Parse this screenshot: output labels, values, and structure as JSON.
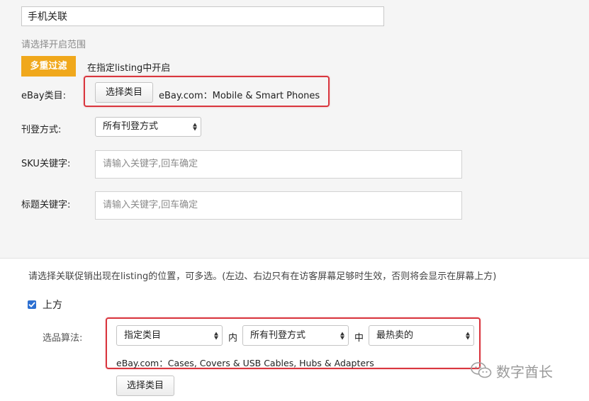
{
  "form": {
    "name_value": "手机关联",
    "range_title": "请选择开启范围",
    "filter_button": "多重过滤",
    "listing_text": "在指定listing中开启",
    "ebay_category": {
      "label": "eBay类目:",
      "button": "选择类目",
      "value": "eBay.com：Mobile & Smart Phones"
    },
    "listing_method": {
      "label": "刊登方式:",
      "selected": "所有刊登方式"
    },
    "sku_keyword": {
      "label": "SKU关键字:",
      "placeholder": "请输入关键字,回车确定"
    },
    "title_keyword": {
      "label": "标题关键字:",
      "placeholder": "请输入关键字,回车确定"
    }
  },
  "position": {
    "instruction": "请选择关联促销出现在listing的位置，可多选。(左边、右边只有在访客屏幕足够时生效，否则将会显示在屏幕上方)",
    "top_checkbox_label": "上方",
    "top_checked": true,
    "algorithm": {
      "label": "选品算法:",
      "select1": "指定类目",
      "in_text": "内",
      "select2": "所有刊登方式",
      "mid_text": "中",
      "select3": "最热卖的",
      "category_value": "eBay.com：Cases, Covers & USB Cables, Hubs & Adapters",
      "button": "选择类目"
    }
  },
  "watermark": {
    "text": "数字酋长",
    "icon": "wechat-icon"
  },
  "colors": {
    "accent": "#f0a81c",
    "highlight": "#d9363e",
    "checkbox": "#2c6fd1"
  }
}
